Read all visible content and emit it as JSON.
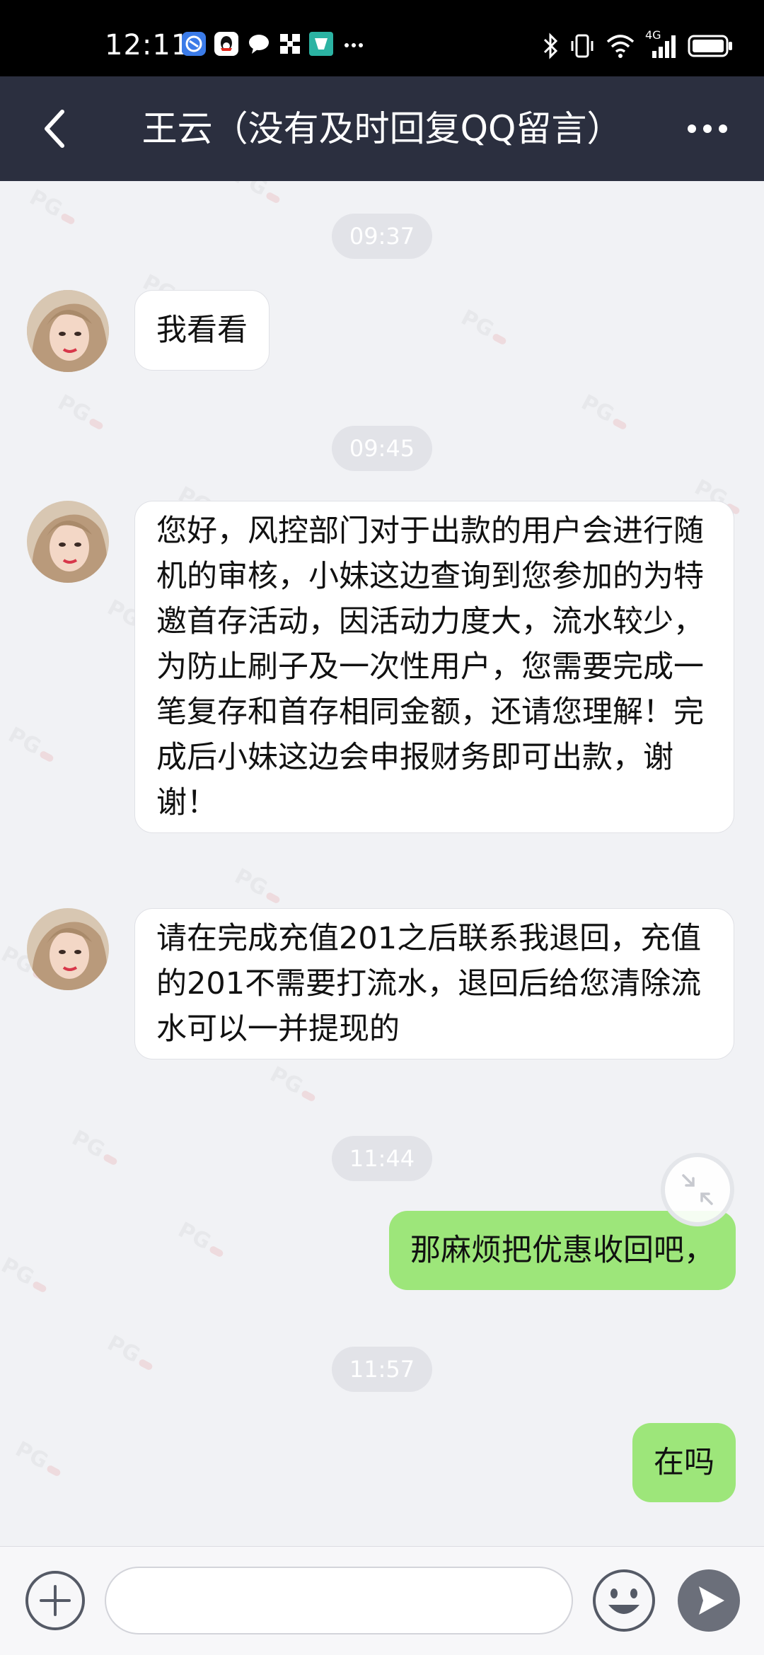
{
  "status_bar": {
    "time": "12:11",
    "left_icons": [
      "browser-icon",
      "qq-icon",
      "message-bubble-icon",
      "apps-grid-icon",
      "store-icon",
      "more-notifications-icon"
    ],
    "right_icons": [
      "bluetooth-icon",
      "vibrate-icon",
      "wifi-icon",
      "cellular-4g-icon",
      "battery-icon"
    ],
    "network_label": "4G"
  },
  "nav": {
    "title": "王云（没有及时回复QQ留言）",
    "back_icon": "chevron-left-icon",
    "more_icon": "more-dots-icon"
  },
  "watermark_text": "PG",
  "chat": {
    "messages": [
      {
        "type": "time",
        "text": "09:37"
      },
      {
        "type": "incoming",
        "text": "我看看"
      },
      {
        "type": "time",
        "text": "09:45"
      },
      {
        "type": "incoming",
        "text": "您好，风控部门对于出款的用户会进行随机的审核，小妹这边查询到您参加的为特邀首存活动，因活动力度大，流水较少，为防止刷子及一次性用户，您需要完成一笔复存和首存相同金额，还请您理解！完成后小妹这边会申报财务即可出款，谢谢！"
      },
      {
        "type": "incoming",
        "text": "请在完成充值201之后联系我退回，充值的201不需要打流水，退回后给您清除流水可以一并提现的"
      },
      {
        "type": "time",
        "text": "11:44"
      },
      {
        "type": "outgoing",
        "text": "那麻烦把优惠收回吧，"
      },
      {
        "type": "time",
        "text": "11:57"
      },
      {
        "type": "outgoing",
        "text": "在吗"
      }
    ],
    "float_icon": "collapse-arrows-icon"
  },
  "composer": {
    "placeholder": "",
    "value": "",
    "add_icon": "plus-circle-icon",
    "emoji_icon": "smile-face-icon",
    "send_icon": "send-arrow-icon"
  },
  "colors": {
    "nav_bg": "#2b2f3f",
    "chat_bg": "#f1f2f5",
    "outgoing_bubble": "#9de67a",
    "incoming_bubble": "#ffffff",
    "time_pill": "#e2e3e8"
  }
}
